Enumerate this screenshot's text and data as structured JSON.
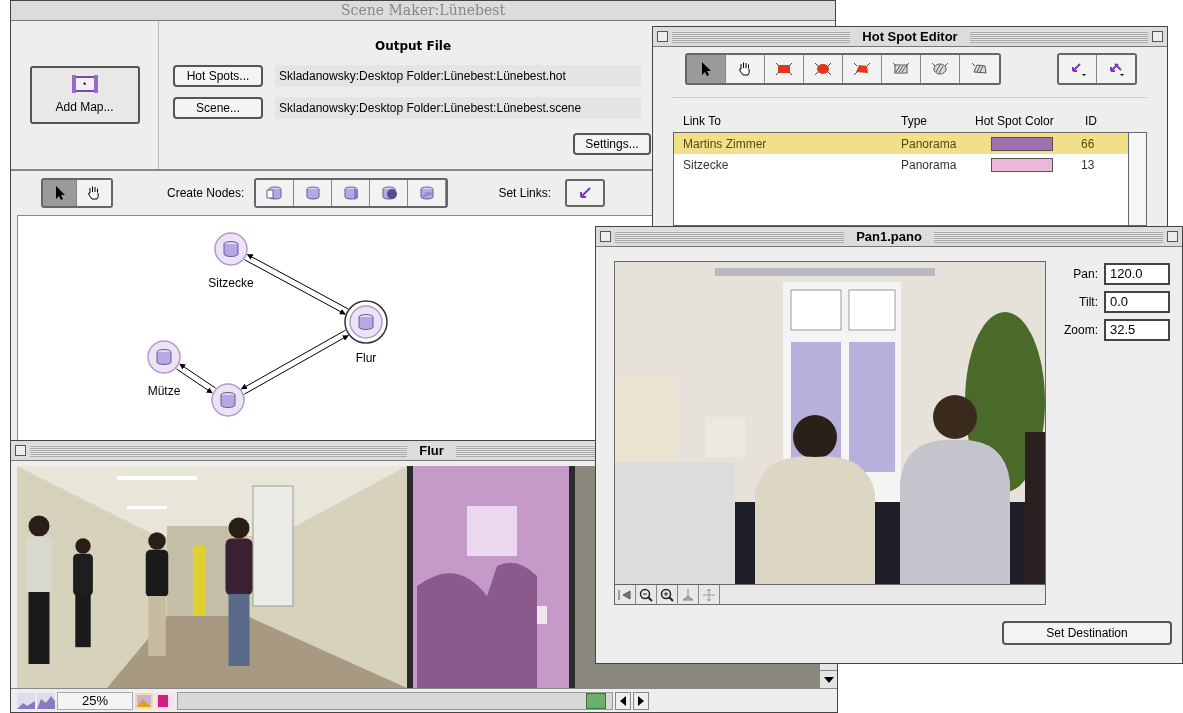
{
  "scene_maker": {
    "title": "Scene Maker:Lünebest",
    "add_map_button": "Add Map...",
    "output_file": {
      "heading": "Output File",
      "rows": [
        {
          "button": "Hot Spots...",
          "path": "Skladanowsky:Desktop Folder:Lünebest:Lünebest.hot"
        },
        {
          "button": "Scene...",
          "path": "Skladanowsky:Desktop Folder:Lünebest:Lünebest.scene"
        }
      ]
    },
    "settings_button": "Settings...",
    "tools": [
      {
        "kind": "arrow",
        "selected": true
      },
      {
        "kind": "hand",
        "selected": false
      }
    ],
    "create_nodes_label": "Create Nodes:",
    "set_links_label": "Set Links:",
    "nodes": [
      {
        "label": "Sitzecke",
        "selected": false
      },
      {
        "label": "Flur",
        "selected": true
      },
      {
        "label": "Mütze",
        "selected": false
      },
      {
        "selected": false
      }
    ]
  },
  "hot_spot_editor": {
    "title": "Hot Spot Editor",
    "tools": [
      {
        "kind": "arrow",
        "selected": true
      },
      {
        "kind": "hand",
        "selected": false
      },
      {
        "kind": "rect",
        "selected": false
      },
      {
        "kind": "oval",
        "selected": false
      },
      {
        "kind": "poly",
        "selected": false
      },
      {
        "kind": "rect-hatch",
        "selected": false
      },
      {
        "kind": "oval-hatch",
        "selected": false
      },
      {
        "kind": "poly-hatch",
        "selected": false
      }
    ],
    "columns": [
      "Link To",
      "Type",
      "Hot Spot Color",
      "ID"
    ],
    "rows": [
      {
        "link_to": "Martins Zimmer",
        "type": "Panorama",
        "color": "#a070b0",
        "id": "66",
        "selected": true
      },
      {
        "link_to": "Sitzecke",
        "type": "Panorama",
        "color": "#ecb8d8",
        "id": "13",
        "selected": false
      }
    ]
  },
  "flur_window": {
    "title": "Flur",
    "zoom": "25%"
  },
  "pano_window": {
    "title": "Pan1.pano",
    "fields": [
      {
        "label": "Pan:",
        "value": "120.0"
      },
      {
        "label": "Tilt:",
        "value": "0.0"
      },
      {
        "label": "Zoom:",
        "value": "32.5"
      }
    ],
    "set_destination_button": "Set Destination"
  }
}
